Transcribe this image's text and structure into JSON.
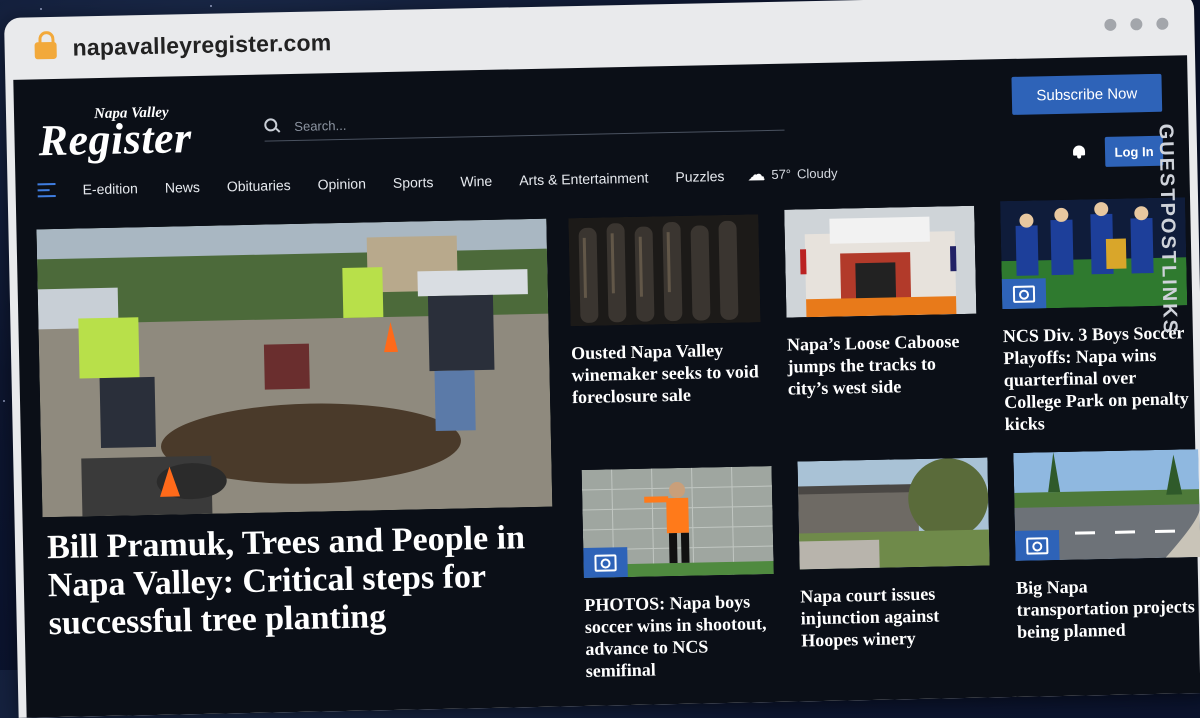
{
  "browser": {
    "url": "napavalleyregister.com"
  },
  "header": {
    "logo_small": "Napa Valley",
    "logo_big": "Register",
    "search_placeholder": "Search...",
    "subscribe_label": "Subscribe Now",
    "login_label": "Log In"
  },
  "nav": {
    "items": [
      "E-edition",
      "News",
      "Obituaries",
      "Opinion",
      "Sports",
      "Wine",
      "Arts & Entertainment",
      "Puzzles"
    ],
    "weather": {
      "temp": "57°",
      "condition": "Cloudy",
      "icon": "cloud-icon"
    }
  },
  "lead": {
    "title": "Bill Pramuk, Trees and People in Napa Valley: Critical steps for successful tree planting"
  },
  "stories": [
    {
      "headline": "Ousted Napa Valley winemaker seeks to void foreclosure sale",
      "has_gallery": false
    },
    {
      "headline": "Napa’s Loose Caboose jumps the tracks to city’s west side",
      "has_gallery": false
    },
    {
      "headline": "NCS Div. 3 Boys Soccer Playoffs: Napa wins quarterfinal over College Park on penalty kicks",
      "has_gallery": true
    },
    {
      "headline": "PHOTOS: Napa boys soccer wins in shootout, advance to NCS semifinal",
      "has_gallery": true
    },
    {
      "headline": "Napa court issues injunction against Hoopes winery",
      "has_gallery": false
    },
    {
      "headline": "Big Napa transportation projects being planned",
      "has_gallery": true
    }
  ],
  "watermark": "GUESTPOSTLINKS",
  "colors": {
    "accent": "#2e63b8",
    "page_bg": "#0b0f17",
    "lock": "#f2a93b"
  }
}
